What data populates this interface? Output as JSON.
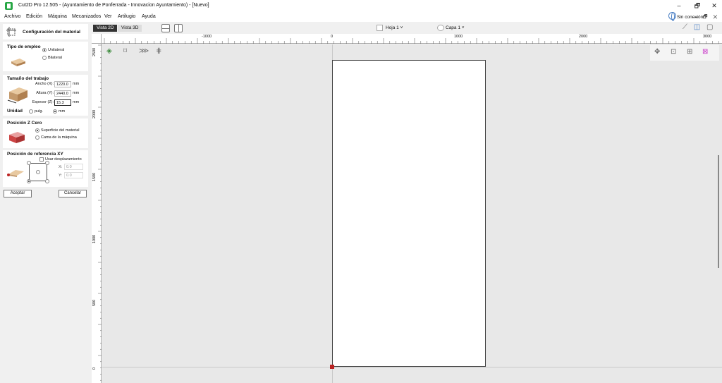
{
  "window": {
    "title": "Cut2D Pro 12.505 - (Ayuntamiento de Ponferrada - Innovacion Ayuntamiento) - [Nuevo]",
    "min": "–",
    "max": "🗗",
    "close": "✕"
  },
  "menu": [
    "Archivo",
    "Edición",
    "Máquina",
    "Mecanizados",
    "Ver",
    "Artilugio",
    "Ayuda"
  ],
  "connection": "Sin conexión",
  "sub_controls": "– 🗗 ✕",
  "panel": {
    "title": "Configuración del material",
    "tipo": {
      "title": "Tipo de empleo",
      "opt1": "Unilateral",
      "opt2": "Bilateral"
    },
    "size": {
      "title": "Tamaño del trabajo",
      "width_label": "Ancho (X):",
      "width_value": "1220.0",
      "height_label": "Altura (Y):",
      "height_value": "2440.0",
      "thick_label": "Espesor (Z):",
      "thick_value": "15.3",
      "unit": "mm",
      "unidad_label": "Unidad",
      "unidad_opt1": "pulg.",
      "unidad_opt2": "mm"
    },
    "zero": {
      "title": "Posición Z Cero",
      "opt1": "Superficie del material",
      "opt2": "Cama de la máquina"
    },
    "xy": {
      "title": "Posición de referencia XY",
      "offset_label": "Usar desplazamiento",
      "x_label": "X:",
      "x_value": "0.0",
      "y_label": "Y:",
      "y_value": "0.0"
    },
    "ok": "Aceptar",
    "cancel": "Cancelar"
  },
  "tabs": {
    "view2d": "Vista 2D",
    "view3d": "Vista 3D"
  },
  "sheet_label": "Hoja 1 ˅",
  "layer_label": "Capa 1 ˅",
  "ruler_top": [
    "-1000",
    "0",
    "1000",
    "2000",
    "3000"
  ],
  "ruler_left": [
    "2500",
    "2000",
    "1500",
    "1000",
    "500",
    "0"
  ]
}
